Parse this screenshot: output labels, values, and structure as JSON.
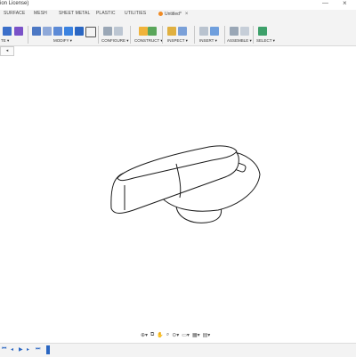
{
  "window": {
    "title_fragment": "ion License)",
    "minimize_glyph": "—",
    "close_glyph": "×"
  },
  "workspace_tabs": [
    {
      "label": "SURFACE"
    },
    {
      "label": "MESH"
    },
    {
      "label": "SHEET METAL"
    },
    {
      "label": "PLASTIC"
    },
    {
      "label": "UTILITIES"
    }
  ],
  "document": {
    "name": "Untitled*",
    "close_glyph": "×"
  },
  "toolbar_groups": [
    {
      "label": "TE ▾"
    },
    {
      "label": "MODIFY ▾"
    },
    {
      "label": "CONFIGURE ▾"
    },
    {
      "label": "CONSTRUCT ▾"
    },
    {
      "label": "INSPECT ▾"
    },
    {
      "label": "INSERT ▾"
    },
    {
      "label": "ASSEMBLE ▾"
    },
    {
      "label": "SELECT ▾"
    }
  ],
  "browser": {
    "toggle_glyph": "◂"
  },
  "navbar_icons": [
    "⊕▾",
    "⧉",
    "✋",
    "⌕",
    "⊙▾",
    "▭▾",
    "▦▾",
    "▤▾"
  ],
  "timeline_icons": [
    "⏮",
    "◂",
    "▶",
    "▸",
    "⏭"
  ],
  "colors": {
    "accent_blue": "#2a66c2",
    "toolbar_bg": "#f3f3f3",
    "document_dot": "#f08a22"
  }
}
